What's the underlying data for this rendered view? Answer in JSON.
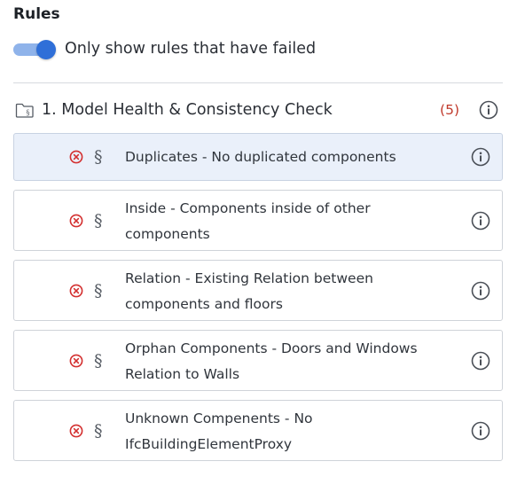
{
  "section": {
    "title": "Rules"
  },
  "filter_toggle": {
    "label": "Only show rules that have failed",
    "enabled": true
  },
  "group": {
    "title": "1. Model Health & Consistency Check",
    "count": "(5)"
  },
  "rules": [
    {
      "text": "Duplicates - No duplicated components",
      "status": "failed",
      "selected": true
    },
    {
      "text": "Inside - Components inside of other components",
      "status": "failed",
      "selected": false
    },
    {
      "text": "Relation - Existing Relation between components and floors",
      "status": "failed",
      "selected": false
    },
    {
      "text": "Orphan Components - Doors and Windows Relation to Walls",
      "status": "failed",
      "selected": false
    },
    {
      "text": "Unknown Compenents - No IfcBuildingElementProxy",
      "status": "failed",
      "selected": false
    }
  ],
  "colors": {
    "accent": "#2f6fd8",
    "fail": "#d32f2f",
    "selected_bg": "#eaf0fa"
  },
  "icons": {
    "group": "folder-rules-icon",
    "rule_status": "error-circle-icon",
    "rule_type": "section-sign-icon",
    "info": "info-icon"
  }
}
